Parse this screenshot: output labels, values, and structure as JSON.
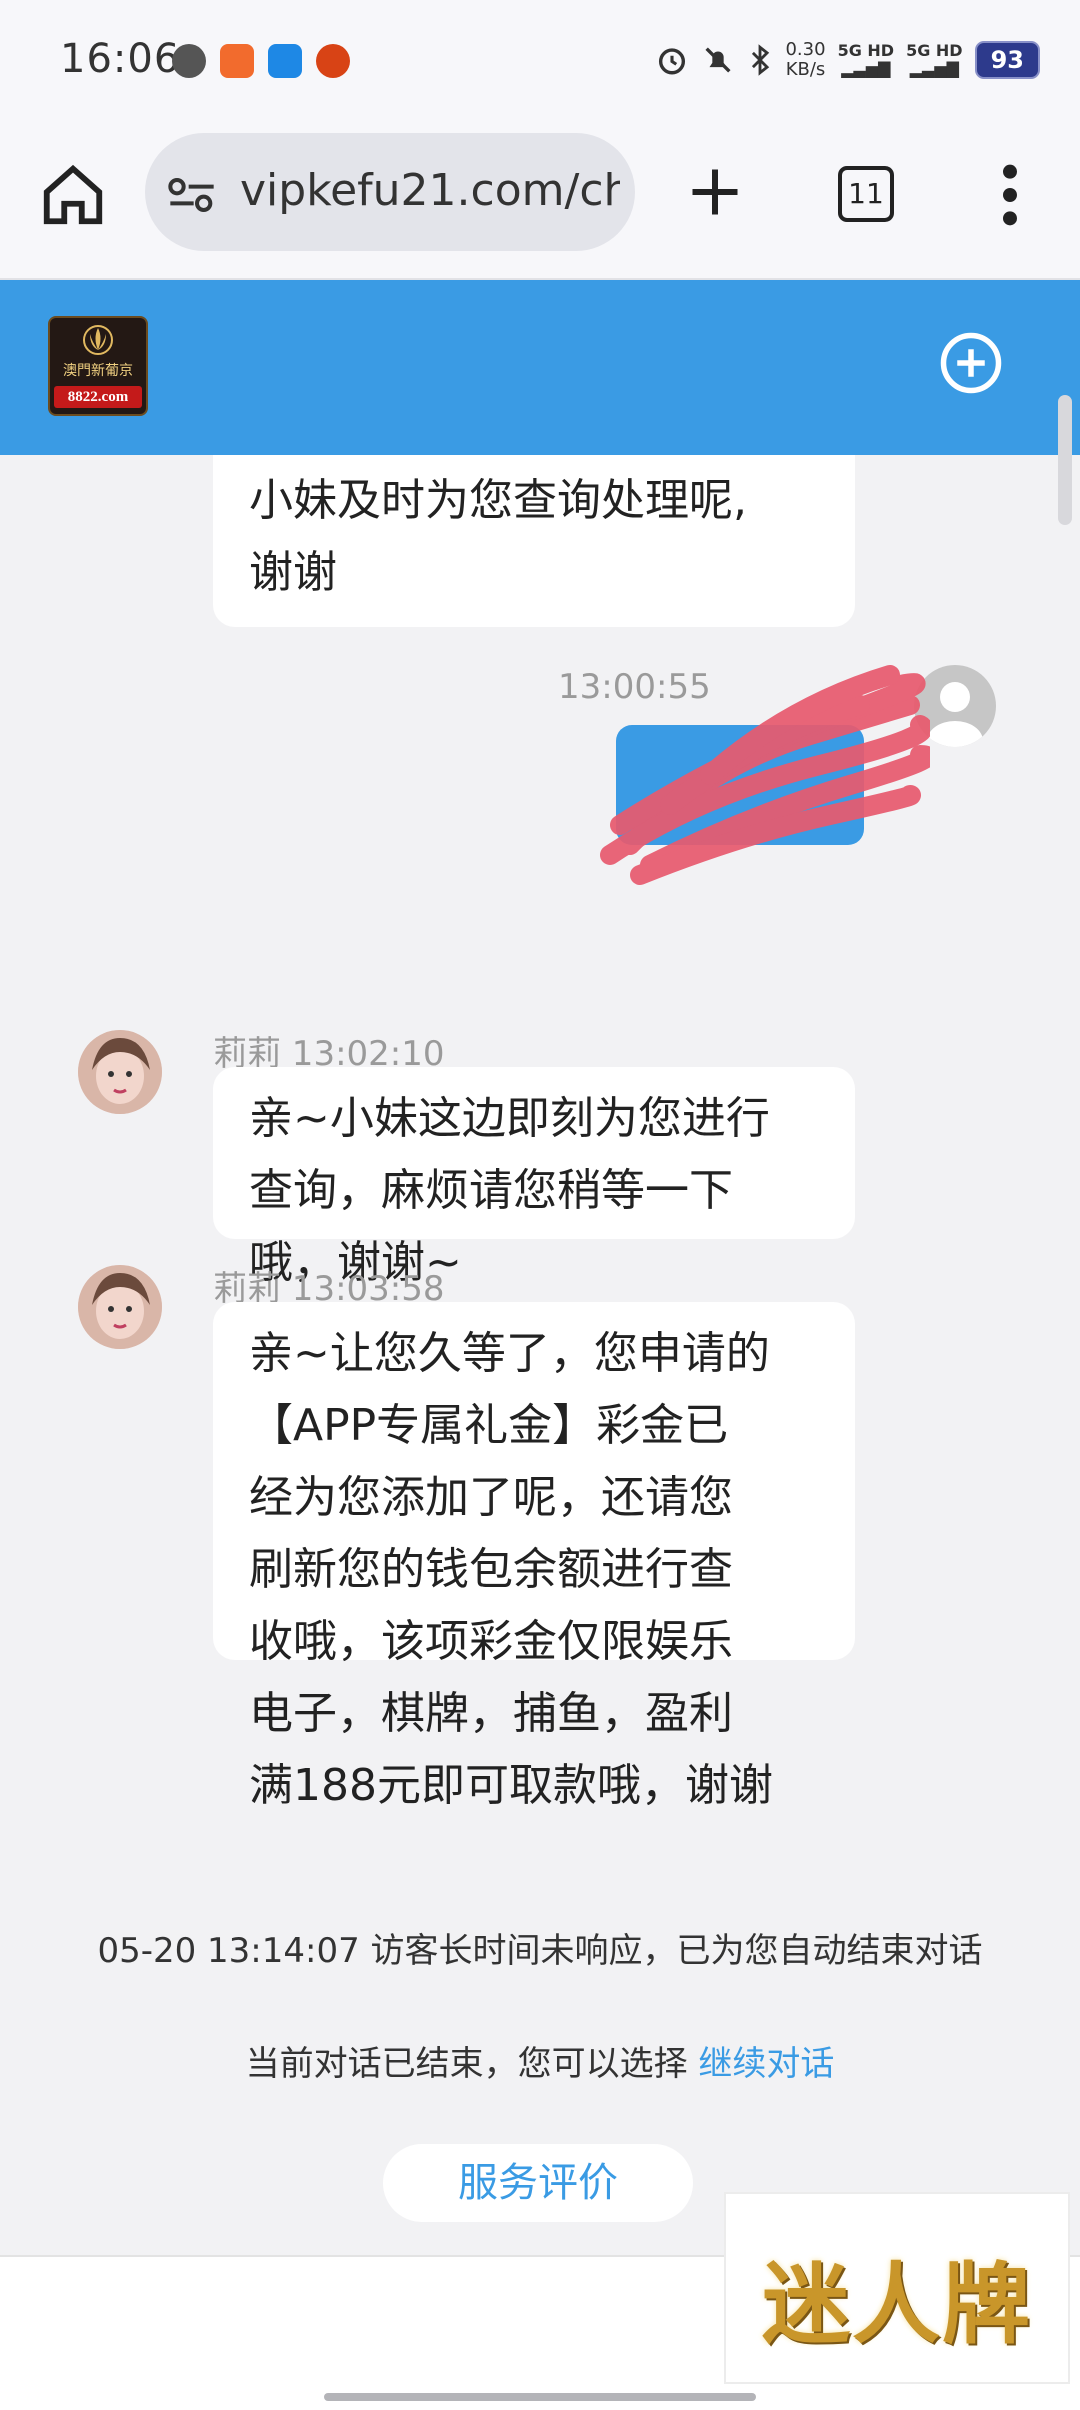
{
  "status_bar": {
    "time": "16:06",
    "speed_value": "0.30",
    "speed_unit": "KB/s",
    "sim1": "5G HD",
    "sim2": "5G HD",
    "battery": "93"
  },
  "browser": {
    "url": "vipkefu21.com/ch",
    "tab_count": "11"
  },
  "site": {
    "logo_text": "澳門新葡京",
    "logo_domain": "8822.com"
  },
  "messages": {
    "partial_agent": [
      "小妹及时为您查询处理呢,",
      "谢谢"
    ],
    "user_time": "13:00:55",
    "agent1_meta": "莉莉 13:02:10",
    "agent1_lines": [
      "亲~小妹这边即刻为您进行",
      "查询，麻烦请您稍等一下",
      "哦，谢谢~"
    ],
    "agent2_meta": "莉莉 13:03:58",
    "agent2_lines": [
      "亲~让您久等了，您申请的",
      "【APP专属礼金】彩金已",
      "经为您添加了呢，还请您",
      "刷新您的钱包余额进行查",
      "收哦，该项彩金仅限娱乐",
      "电子，棋牌，捕鱼，盈利",
      "满188元即可取款哦，谢谢"
    ]
  },
  "system": {
    "timeout_notice": "05-20 13:14:07 访客长时间未响应，已为您自动结束对话",
    "ended_text": "当前对话已结束，您可以选择",
    "continue_link": "继续对话",
    "rate_button": "服务评价"
  },
  "watermark": "迷人牌",
  "colors": {
    "accent": "#3a9be4",
    "background": "#f2f2f4",
    "redaction": "#e85a6e"
  },
  "icons": {
    "home": "home-icon",
    "site_info": "site-info-icon",
    "new_tab": "plus-icon",
    "menu": "more-vert-icon",
    "add_chat": "add-circle-icon"
  }
}
